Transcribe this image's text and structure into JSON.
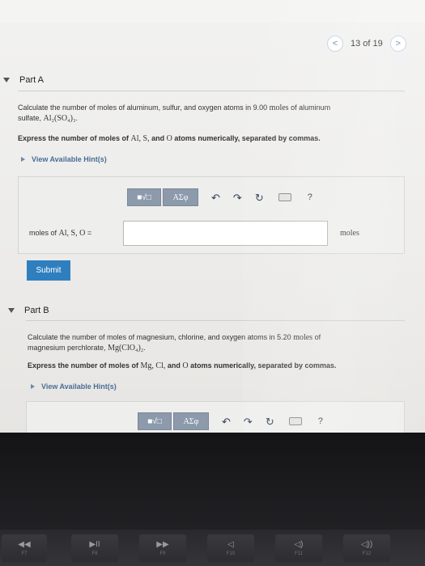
{
  "pager": {
    "prev_icon": "chevron-left-icon",
    "next_icon": "chevron-right-icon",
    "prev_glyph": "<",
    "next_glyph": ">",
    "count": "13 of 19"
  },
  "part_a": {
    "title": "Part A",
    "question_line1": "Calculate the number of moles of aluminum, sulfur, and oxygen atoms in 9.00 ",
    "question_unit": "moles",
    "question_line1_end": " of aluminum",
    "question_line2": "sulfate, ",
    "formula": "Al₂(SO₄)₃",
    "period": ".",
    "express_prefix": "Express the number of moles of ",
    "express_math": "Al, S,",
    "express_and": " and ",
    "express_o": "O",
    "express_suffix": " atoms numerically, separated by commas.",
    "hint": "View Available Hint(s)",
    "answer_label_prefix": "moles of ",
    "answer_label_math": "Al, S, O",
    "answer_label_eq": " =",
    "answer_value": "",
    "unit": "moles",
    "submit": "Submit"
  },
  "part_b": {
    "title": "Part B",
    "question_line1": "Calculate the number of moles of magnesium, chlorine, and oxygen atoms in 5.20 ",
    "question_unit": "moles",
    "question_line1_end": " of",
    "question_line2": "magnesium perchlorate, ",
    "formula": "Mg(ClO₄)₂",
    "period": ".",
    "express_prefix": "Express the number of moles of ",
    "express_math": "Mg, Cl,",
    "express_and": " and ",
    "express_o": "O",
    "express_suffix": " atoms numerically, separated by commas.",
    "hint": "View Available Hint(s)"
  },
  "toolbar": {
    "template": "■√□",
    "greek": "ΑΣφ",
    "undo": "↶",
    "redo": "↷",
    "reset": "↻",
    "help": "?"
  },
  "keyboard": {
    "keys": [
      {
        "symbol": "◀◀",
        "label": "F7"
      },
      {
        "symbol": "▶II",
        "label": "F8"
      },
      {
        "symbol": "▶▶",
        "label": "F9"
      },
      {
        "symbol": "◁",
        "label": "F10"
      },
      {
        "symbol": "◁)",
        "label": "F11"
      },
      {
        "symbol": "◁))",
        "label": "F12"
      }
    ]
  },
  "colors": {
    "submit": "#2f7fbf",
    "hint": "#4a6d96",
    "toolbar": "#8c9aac"
  }
}
